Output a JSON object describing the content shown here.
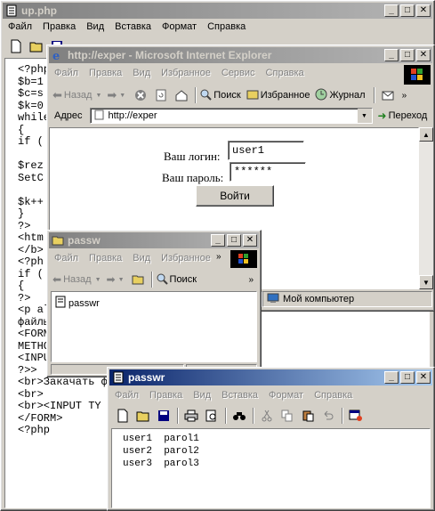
{
  "editor": {
    "title": "up.php",
    "menu": [
      "Файл",
      "Правка",
      "Вид",
      "Вставка",
      "Формат",
      "Справка"
    ],
    "code_lines": [
      "<?php",
      "$b=1",
      "$c=s",
      "$k=0",
      "while",
      "{",
      "if (",
      "",
      "$rez",
      "SetC",
      "",
      "$k++",
      "}",
      "?>",
      "<htm",
      "</b>",
      "<?ph",
      "if (",
      "{",
      "?>",
      "<p al",
      "файлы",
      "<FORM",
      "METHO",
      "<INPU",
      "?>>",
      "<br>Закачать ф",
      "<br>",
      "<br><INPUT TY",
      "</FORM>",
      "<?php"
    ]
  },
  "ie": {
    "title": "http://exper - Microsoft Internet Explorer",
    "menu": [
      "Файл",
      "Правка",
      "Вид",
      "Избранное",
      "Сервис",
      "Справка"
    ],
    "back_label": "Назад",
    "stop_tip": "stop",
    "search_label": "Поиск",
    "favorites_label": "Избранное",
    "history_label": "Журнал",
    "address_label": "Адрес",
    "address_value": "http://exper",
    "go_label": "Переход",
    "status_zone": "Мой компьютер",
    "login_label": "Ваш логин:",
    "login_value": "user1",
    "password_label": "Ваш пароль:",
    "password_value": "******",
    "submit_label": "Войти"
  },
  "explorer": {
    "title": "passw",
    "menu": [
      "Файл",
      "Правка",
      "Вид",
      "Избранное"
    ],
    "back_label": "Назад",
    "search_label": "Поиск",
    "file_name": "passwr"
  },
  "notepad": {
    "title": "passwr",
    "menu": [
      "Файл",
      "Правка",
      "Вид",
      "Вставка",
      "Формат",
      "Справка"
    ],
    "lines": [
      "user1  parol1",
      "user2  parol2",
      "user3  parol3"
    ]
  },
  "colors": {
    "active_title": "#0a246a",
    "inactive_title": "#808080",
    "face": "#d4d0c8"
  }
}
